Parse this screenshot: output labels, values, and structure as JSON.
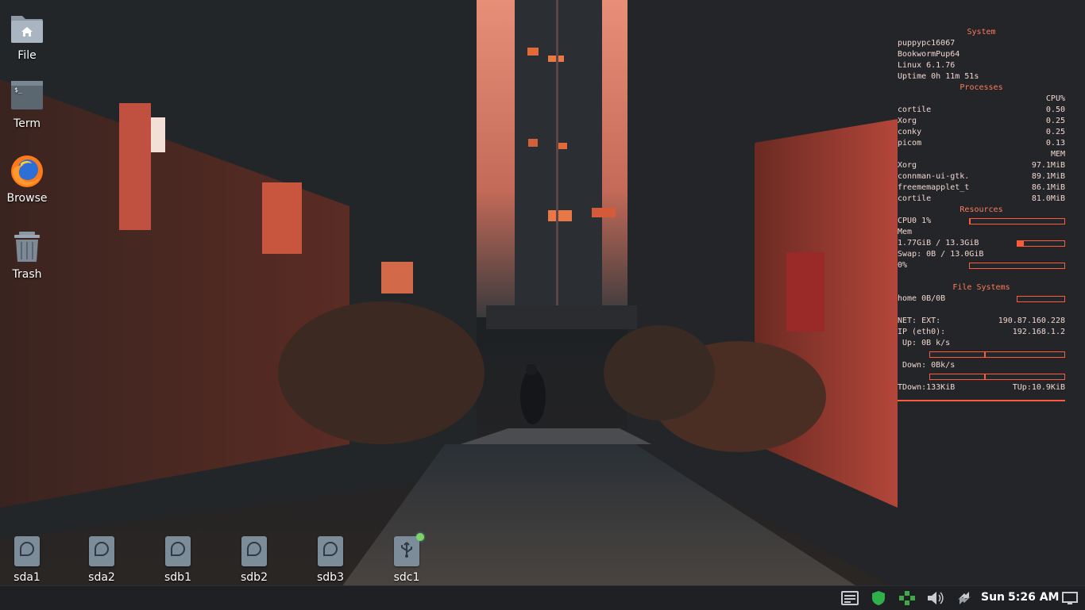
{
  "desktop": {
    "icons": [
      {
        "label": "File",
        "icon": "home-folder-icon"
      },
      {
        "label": "Term",
        "icon": "terminal-icon"
      },
      {
        "label": "Browse",
        "icon": "firefox-icon"
      },
      {
        "label": "Trash",
        "icon": "trash-icon"
      }
    ],
    "drives": [
      {
        "label": "sda1",
        "icon": "drive-icon"
      },
      {
        "label": "sda2",
        "icon": "drive-icon"
      },
      {
        "label": "sdb1",
        "icon": "drive-icon"
      },
      {
        "label": "sdb2",
        "icon": "drive-icon"
      },
      {
        "label": "sdb3",
        "icon": "drive-icon"
      },
      {
        "label": "sdc1",
        "icon": "usb-drive-icon",
        "mounted": true
      }
    ]
  },
  "conky": {
    "system_header": "System",
    "hostname": "puppypc16067",
    "distro": "BookwormPup64",
    "kernel": "Linux 6.1.76",
    "uptime": "Uptime 0h 11m 51s",
    "processes_header": "Processes",
    "cpu_col": "CPU%",
    "cpu_procs": [
      {
        "name": "cortile",
        "value": "0.50"
      },
      {
        "name": "Xorg",
        "value": "0.25"
      },
      {
        "name": "conky",
        "value": "0.25"
      },
      {
        "name": "picom",
        "value": "0.13"
      }
    ],
    "mem_col": "MEM",
    "mem_procs": [
      {
        "name": "Xorg",
        "value": "97.1MiB"
      },
      {
        "name": "connman-ui-gtk.",
        "value": "89.1MiB"
      },
      {
        "name": "freememapplet_t",
        "value": "86.1MiB"
      },
      {
        "name": "cortile",
        "value": "81.0MiB"
      }
    ],
    "resources_header": "Resources",
    "cpu0": "CPU0 1%",
    "cpu0_level": 0.01,
    "mem_label": "Mem",
    "mem_usage": "1.77GiB / 13.3GiB",
    "mem_level": 0.13,
    "swap": "Swap: 0B / 13.0GiB",
    "swap_pct": "0%",
    "swap_level": 0.0,
    "fs_header": "File Systems",
    "fs_home": "home 0B/0B",
    "fs_level": 0.0,
    "net_ext_label": "NET: EXT:",
    "net_ext": "190.87.160.228",
    "ip_label": "IP (eth0):",
    "ip": "192.168.1.2",
    "up": "Up: 0B k/s",
    "down": "Down: 0Bk/s",
    "tdown": "TDown:133KiB",
    "tup": "TUp:10.9KiB"
  },
  "taskbar": {
    "tray_icons": [
      "taskbar-window-icon",
      "shield-icon",
      "network-icon",
      "volume-icon",
      "transfer-icon",
      "show-desktop-icon"
    ],
    "day": "Sun",
    "time": "5:26 AM"
  },
  "colors": {
    "accent": "#ff5a3a",
    "conky_header": "#ff7b5a",
    "taskbar": "#1e2023"
  }
}
